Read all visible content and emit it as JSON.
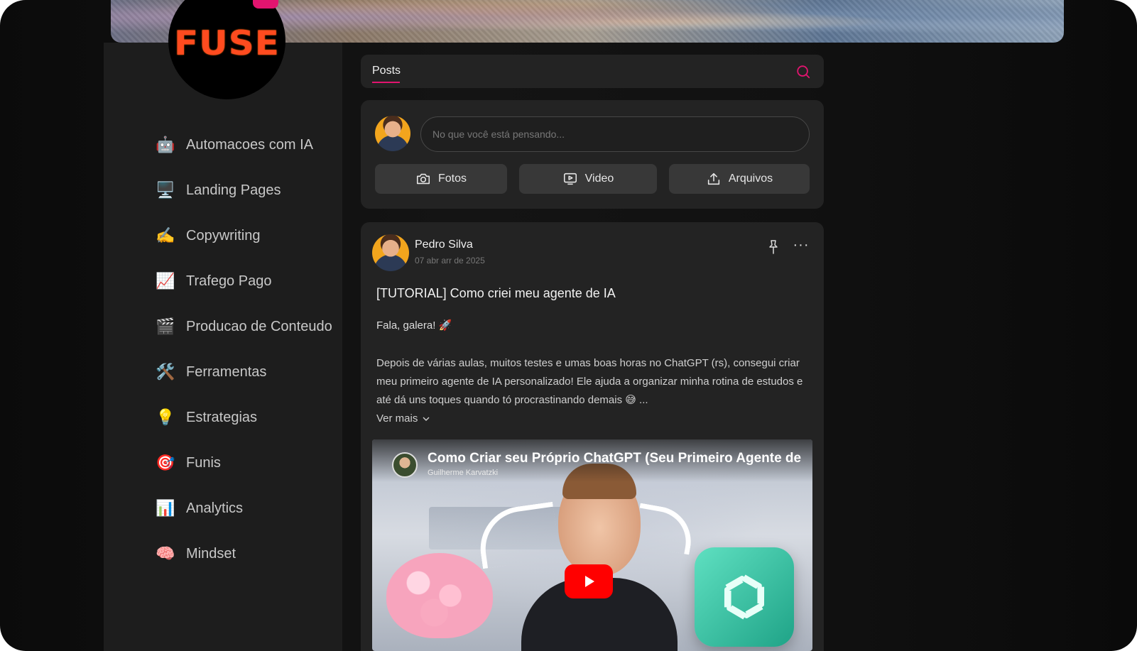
{
  "brand": {
    "logo_text": "FUSE",
    "accent": "#e2146f",
    "logo_color": "#ff4b1f"
  },
  "sidebar": {
    "items": [
      {
        "icon": "robot-icon",
        "glyph": "🤖",
        "label": "Automacoes com IA"
      },
      {
        "icon": "desktop-computer-icon",
        "glyph": "🖥️",
        "label": "Landing Pages"
      },
      {
        "icon": "writing-hand-icon",
        "glyph": "✍️",
        "label": "Copywriting"
      },
      {
        "icon": "chart-increasing-icon",
        "glyph": "📈",
        "label": "Trafego Pago"
      },
      {
        "icon": "clapper-board-icon",
        "glyph": "🎬",
        "label": "Producao de Conteudo"
      },
      {
        "icon": "hammer-wrench-icon",
        "glyph": "🛠️",
        "label": "Ferramentas"
      },
      {
        "icon": "light-bulb-icon",
        "glyph": "💡",
        "label": "Estrategias"
      },
      {
        "icon": "target-icon",
        "glyph": "🎯",
        "label": "Funis"
      },
      {
        "icon": "bar-chart-icon",
        "glyph": "📊",
        "label": "Analytics"
      },
      {
        "icon": "brain-icon",
        "glyph": "🧠",
        "label": "Mindset"
      }
    ]
  },
  "tabs": {
    "posts_label": "Posts"
  },
  "composer": {
    "placeholder": "No que você está pensando...",
    "photos_label": "Fotos",
    "video_label": "Video",
    "files_label": "Arquivos"
  },
  "post": {
    "author": "Pedro Silva",
    "date": "07 abr arr de 2025",
    "title": "[TUTORIAL] Como criei meu agente de IA",
    "greeting": "Fala, galera! 🚀",
    "body": "Depois de várias aulas, muitos testes e umas boas horas no ChatGPT (rs), consegui criar meu primeiro agente de IA personalizado! Ele ajuda a organizar minha rotina de estudos e até dá uns toques quando tó procrastinando demais 😅 ...",
    "see_more": "Ver mais",
    "more_glyph": "···"
  },
  "video": {
    "title": "Como Criar seu Próprio ChatGPT (Seu Primeiro Agente de",
    "channel": "Guilherme Karvatzki"
  }
}
